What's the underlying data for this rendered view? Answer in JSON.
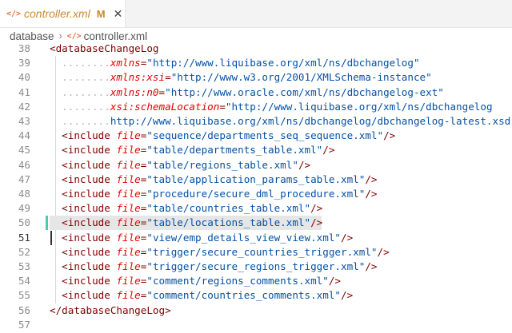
{
  "tab": {
    "title": "controller.xml",
    "modified_flag": "M",
    "close_glyph": "✕",
    "icon": "xml-file-icon"
  },
  "breadcrumb": {
    "folder": "database",
    "separator": "›",
    "file": "controller.xml"
  },
  "colors": {
    "tag": "#800000",
    "attribute": "#e50000",
    "string": "#0451a5",
    "modified": "#c88b2a",
    "added_bar": "#4ec9b0"
  },
  "lines": [
    {
      "num": "38",
      "parts": [
        [
          "punct",
          "<"
        ],
        [
          "tag",
          "databaseChangeLog"
        ]
      ]
    },
    {
      "num": "39",
      "indent": "........",
      "parts": [
        [
          "attr",
          "xmlns"
        ],
        [
          "punct",
          "="
        ],
        [
          "strp",
          "\"http://www.liquibase.org/xml/ns/dbchangelog\""
        ]
      ]
    },
    {
      "num": "40",
      "indent": "........",
      "parts": [
        [
          "attr",
          "xmlns:xsi"
        ],
        [
          "punct",
          "="
        ],
        [
          "strp",
          "\"http://www.w3.org/2001/XMLSchema-instance\""
        ]
      ]
    },
    {
      "num": "41",
      "indent": "........",
      "parts": [
        [
          "attr",
          "xmlns:n0"
        ],
        [
          "punct",
          "="
        ],
        [
          "strp",
          "\"http://www.oracle.com/xml/ns/dbchangelog-ext\""
        ]
      ]
    },
    {
      "num": "42",
      "indent": "........",
      "parts": [
        [
          "attr",
          "xsi:schemaLocation"
        ],
        [
          "punct",
          "="
        ],
        [
          "strp",
          "\"http://www.liquibase.org/xml/ns/dbchangelog"
        ]
      ]
    },
    {
      "num": "43",
      "indent": "........",
      "parts": [
        [
          "strp",
          "http://www.liquibase.org/xml/ns/dbchangelog/dbchangelog-latest.xsd\""
        ],
        [
          "punct",
          ">"
        ]
      ]
    },
    {
      "num": "44",
      "parts": [
        [
          "punct",
          "<"
        ],
        [
          "tag",
          "include"
        ],
        [
          "plain",
          " "
        ],
        [
          "attr",
          "file"
        ],
        [
          "punct",
          "="
        ],
        [
          "strp",
          "\"sequence/departments_seq_sequence.xml\""
        ],
        [
          "punct",
          "/>"
        ]
      ]
    },
    {
      "num": "45",
      "parts": [
        [
          "punct",
          "<"
        ],
        [
          "tag",
          "include"
        ],
        [
          "plain",
          " "
        ],
        [
          "attr",
          "file"
        ],
        [
          "punct",
          "="
        ],
        [
          "strp",
          "\"table/departments_table.xml\""
        ],
        [
          "punct",
          "/>"
        ]
      ]
    },
    {
      "num": "46",
      "parts": [
        [
          "punct",
          "<"
        ],
        [
          "tag",
          "include"
        ],
        [
          "plain",
          " "
        ],
        [
          "attr",
          "file"
        ],
        [
          "punct",
          "="
        ],
        [
          "strp",
          "\"table/regions_table.xml\""
        ],
        [
          "punct",
          "/>"
        ]
      ]
    },
    {
      "num": "47",
      "parts": [
        [
          "punct",
          "<"
        ],
        [
          "tag",
          "include"
        ],
        [
          "plain",
          " "
        ],
        [
          "attr",
          "file"
        ],
        [
          "punct",
          "="
        ],
        [
          "strp",
          "\"table/application_params_table.xml\""
        ],
        [
          "punct",
          "/>"
        ]
      ]
    },
    {
      "num": "48",
      "parts": [
        [
          "punct",
          "<"
        ],
        [
          "tag",
          "include"
        ],
        [
          "plain",
          " "
        ],
        [
          "attr",
          "file"
        ],
        [
          "punct",
          "="
        ],
        [
          "strp",
          "\"procedure/secure_dml_procedure.xml\""
        ],
        [
          "punct",
          "/>"
        ]
      ]
    },
    {
      "num": "49",
      "parts": [
        [
          "punct",
          "<"
        ],
        [
          "tag",
          "include"
        ],
        [
          "plain",
          " "
        ],
        [
          "attr",
          "file"
        ],
        [
          "punct",
          "="
        ],
        [
          "strp",
          "\"table/countries_table.xml\""
        ],
        [
          "punct",
          "/>"
        ]
      ]
    },
    {
      "num": "50",
      "parts": [
        [
          "punct",
          "<"
        ],
        [
          "tag",
          "include"
        ],
        [
          "plain",
          " "
        ],
        [
          "attr",
          "file"
        ],
        [
          "punct",
          "="
        ],
        [
          "strp",
          "\"table/locations_table.xml\""
        ],
        [
          "punct",
          "/>"
        ]
      ]
    },
    {
      "num": "51",
      "parts": [
        [
          "punct",
          "<"
        ],
        [
          "tag",
          "include"
        ],
        [
          "plain",
          " "
        ],
        [
          "attr",
          "file"
        ],
        [
          "punct",
          "="
        ],
        [
          "strp",
          "\"view/emp_details_view_view.xml\""
        ],
        [
          "punct",
          "/>"
        ]
      ]
    },
    {
      "num": "52",
      "parts": [
        [
          "punct",
          "<"
        ],
        [
          "tag",
          "include"
        ],
        [
          "plain",
          " "
        ],
        [
          "attr",
          "file"
        ],
        [
          "punct",
          "="
        ],
        [
          "strp",
          "\"trigger/secure_countries_trigger.xml\""
        ],
        [
          "punct",
          "/>"
        ]
      ]
    },
    {
      "num": "53",
      "parts": [
        [
          "punct",
          "<"
        ],
        [
          "tag",
          "include"
        ],
        [
          "plain",
          " "
        ],
        [
          "attr",
          "file"
        ],
        [
          "punct",
          "="
        ],
        [
          "strp",
          "\"trigger/secure_regions_trigger.xml\""
        ],
        [
          "punct",
          "/>"
        ]
      ]
    },
    {
      "num": "54",
      "parts": [
        [
          "punct",
          "<"
        ],
        [
          "tag",
          "include"
        ],
        [
          "plain",
          " "
        ],
        [
          "attr",
          "file"
        ],
        [
          "punct",
          "="
        ],
        [
          "strp",
          "\"comment/regions_comments.xml\""
        ],
        [
          "punct",
          "/>"
        ]
      ]
    },
    {
      "num": "55",
      "parts": [
        [
          "punct",
          "<"
        ],
        [
          "tag",
          "include"
        ],
        [
          "plain",
          " "
        ],
        [
          "attr",
          "file"
        ],
        [
          "punct",
          "="
        ],
        [
          "strp",
          "\"comment/countries_comments.xml\""
        ],
        [
          "punct",
          "/>"
        ]
      ]
    },
    {
      "num": "56",
      "parts": [
        [
          "punct",
          "</"
        ],
        [
          "tag",
          "databaseChangeLog"
        ],
        [
          "punct",
          ">"
        ]
      ]
    },
    {
      "num": "57",
      "parts": []
    }
  ],
  "editor_state": {
    "highlighted_line": "50",
    "cursor_line": "51",
    "changed_line": "50"
  }
}
